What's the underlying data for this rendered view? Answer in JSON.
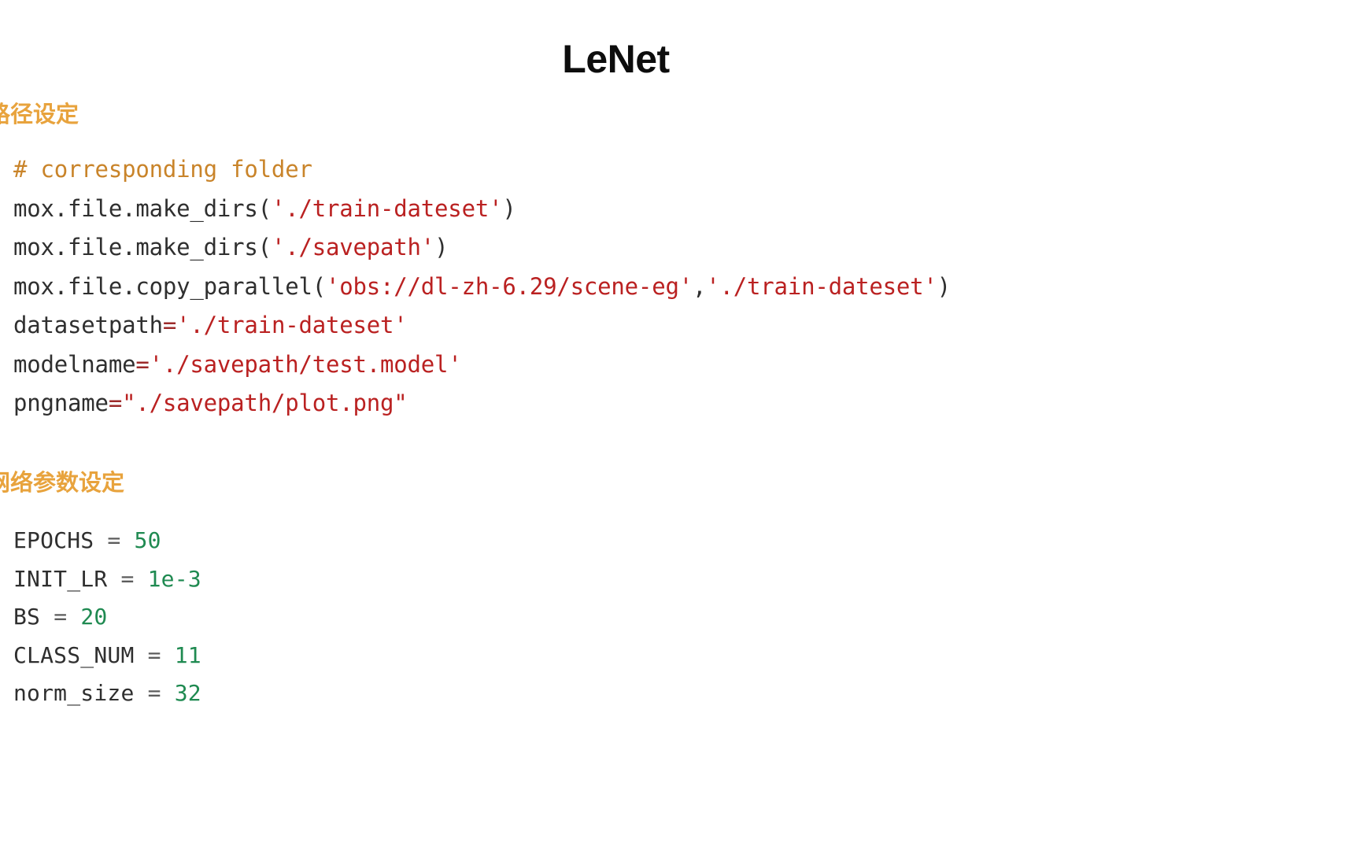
{
  "slide": {
    "title": "LeNet",
    "background_color": "#ffffff"
  },
  "colors": {
    "title": "#0d0d0d",
    "heading_orange": "#E8A33D",
    "code_comment": "#C9842A",
    "code_string": "#BA2121",
    "code_plain": "#2f2f2f",
    "code_number": "#1F8A51",
    "code_operator": "#5c5c5c"
  },
  "sections": [
    {
      "heading": "路径设定",
      "code_lines": [
        {
          "tokens": [
            {
              "text": "# corresponding folder",
              "type": "comment"
            }
          ]
        },
        {
          "tokens": [
            {
              "text": "mox.file.make_dirs(",
              "type": "plain"
            },
            {
              "text": "'./train-dateset'",
              "type": "string"
            },
            {
              "text": ")",
              "type": "plain"
            }
          ]
        },
        {
          "tokens": [
            {
              "text": "mox.file.make_dirs(",
              "type": "plain"
            },
            {
              "text": "'./savepath'",
              "type": "string"
            },
            {
              "text": ")",
              "type": "plain"
            }
          ]
        },
        {
          "tokens": [
            {
              "text": "mox.file.copy_parallel(",
              "type": "plain"
            },
            {
              "text": "'obs://dl-zh-6.29/scene-eg'",
              "type": "string"
            },
            {
              "text": ",",
              "type": "plain"
            },
            {
              "text": "'./train-dateset'",
              "type": "string"
            },
            {
              "text": ")",
              "type": "plain"
            }
          ]
        },
        {
          "tokens": [
            {
              "text": "datasetpath",
              "type": "plain"
            },
            {
              "text": "=",
              "type": "operator"
            },
            {
              "text": "'./train-dateset'",
              "type": "string"
            }
          ]
        },
        {
          "tokens": [
            {
              "text": "modelname",
              "type": "plain"
            },
            {
              "text": "=",
              "type": "operator"
            },
            {
              "text": "'./savepath/test.model'",
              "type": "string"
            }
          ]
        },
        {
          "tokens": [
            {
              "text": "pngname",
              "type": "plain"
            },
            {
              "text": "=",
              "type": "operator"
            },
            {
              "text": "\"./savepath/plot.png\"",
              "type": "string"
            }
          ]
        }
      ]
    },
    {
      "heading": "网络参数设定",
      "code_lines": [
        {
          "tokens": [
            {
              "text": "EPOCHS ",
              "type": "plain"
            },
            {
              "text": "= ",
              "type": "equals"
            },
            {
              "text": "50",
              "type": "number"
            }
          ]
        },
        {
          "tokens": [
            {
              "text": "INIT_LR ",
              "type": "plain"
            },
            {
              "text": "= ",
              "type": "equals"
            },
            {
              "text": "1e-3",
              "type": "number"
            }
          ]
        },
        {
          "tokens": [
            {
              "text": "BS ",
              "type": "plain"
            },
            {
              "text": "= ",
              "type": "equals"
            },
            {
              "text": "20",
              "type": "number"
            }
          ]
        },
        {
          "tokens": [
            {
              "text": "CLASS_NUM ",
              "type": "plain"
            },
            {
              "text": "= ",
              "type": "equals"
            },
            {
              "text": "11",
              "type": "number"
            }
          ]
        },
        {
          "tokens": [
            {
              "text": "norm_size ",
              "type": "plain"
            },
            {
              "text": "= ",
              "type": "equals"
            },
            {
              "text": "32",
              "type": "number"
            }
          ]
        }
      ]
    }
  ]
}
